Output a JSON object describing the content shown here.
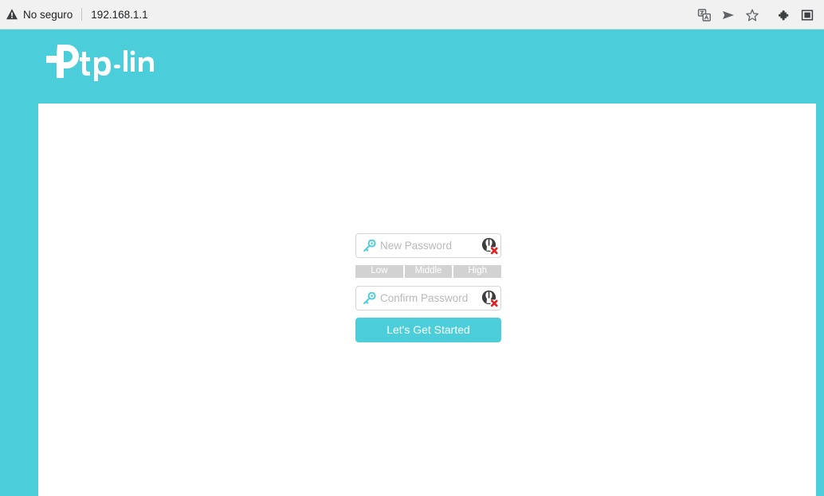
{
  "browser": {
    "security_label": "No seguro",
    "url": "192.168.1.1",
    "icons": {
      "warning": "warning-triangle-icon",
      "translate": "translate-icon",
      "send": "send-icon",
      "bookmark": "star-icon",
      "extensions": "puzzle-piece-icon",
      "sidebar": "sidebar-panel-icon"
    }
  },
  "brand": {
    "name": "tp-link",
    "logo_icon": "tp-link-logo-icon",
    "accent_color": "#4ccdda"
  },
  "form": {
    "new_password": {
      "placeholder": "New Password",
      "value": "",
      "key_icon": "key-icon",
      "toggle_icon": "broken-image-icon"
    },
    "confirm_password": {
      "placeholder": "Confirm Password",
      "value": "",
      "key_icon": "key-icon",
      "toggle_icon": "broken-image-icon"
    },
    "strength": {
      "levels": [
        "Low",
        "Middle",
        "High"
      ],
      "inactive_color": "#d2d2d2",
      "label_color": "#ffffff"
    },
    "submit_label": "Let's Get Started",
    "submit_color": "#4ccdda"
  }
}
